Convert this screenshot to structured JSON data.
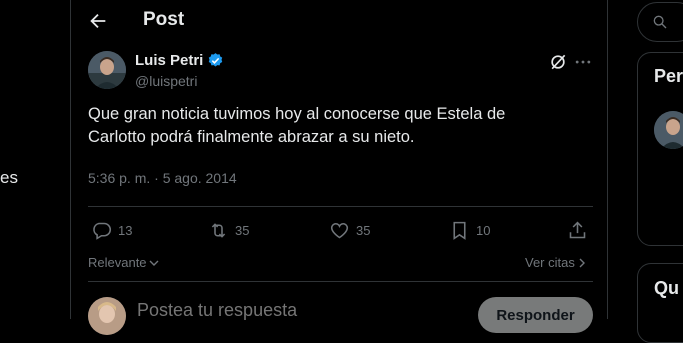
{
  "left_nav": {
    "partial_text": "es"
  },
  "header": {
    "title": "Post",
    "back_icon": "arrow-left-icon"
  },
  "tweet": {
    "author_name": "Luis Petri",
    "author_handle": "@luispetri",
    "text": "Que gran noticia tuvimos hoy al conocerse que Estela de Carlotto podrá finalmente abrazar a su nieto.",
    "timestamp": "5:36 p. m. · 5 ago. 2014",
    "verified_color": "#1d9bf0",
    "actions": {
      "replies": "13",
      "retweets": "35",
      "likes": "35",
      "bookmarks": "10"
    }
  },
  "replies_bar": {
    "sort_label": "Relevante",
    "quotes_label": "Ver citas"
  },
  "composer": {
    "placeholder": "Postea tu respuesta",
    "button_label": "Responder"
  },
  "right_column": {
    "panel_1_title": "Per",
    "panel_2_title": "Qu"
  },
  "colors": {
    "background": "#000000",
    "text": "#e7e9ea",
    "muted": "#71767b",
    "border": "#2f3336"
  }
}
